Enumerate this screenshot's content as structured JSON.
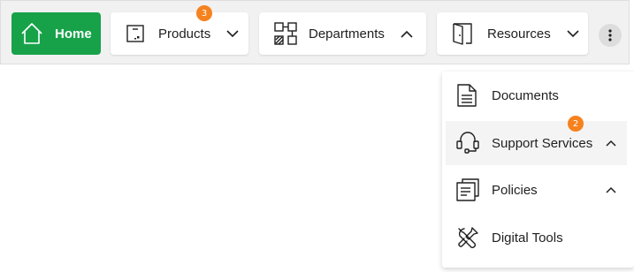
{
  "nav": {
    "home_label": "Home",
    "products_label": "Products",
    "products_badge": "3",
    "departments_label": "Departments",
    "resources_label": "Resources"
  },
  "dropdown": {
    "items": [
      {
        "label": "Documents"
      },
      {
        "label": "Support Services",
        "badge": "2"
      },
      {
        "label": "Policies"
      },
      {
        "label": "Digital Tools"
      }
    ]
  },
  "colors": {
    "home_bg": "#17a24a",
    "badge_bg": "#f5821f",
    "topbar_bg": "#f1f1f1"
  },
  "icons": {
    "home": "home-icon",
    "products": "box-icon",
    "departments": "org-grid-icon",
    "resources": "door-icon",
    "more": "more-vertical-icon",
    "documents": "document-icon",
    "support": "headset-icon",
    "policies": "documents-stack-icon",
    "tools": "wrench-screwdriver-icon"
  }
}
